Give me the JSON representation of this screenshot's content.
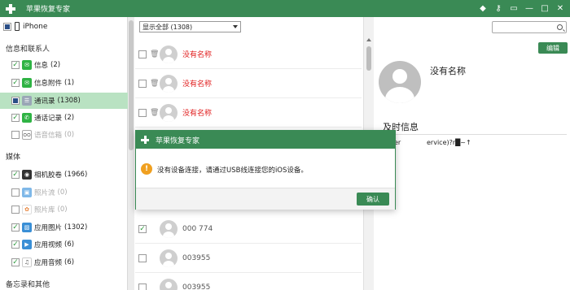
{
  "app": {
    "title": "苹果恢复专家"
  },
  "titlebar_icons": [
    "diamond-icon",
    "key-icon",
    "message-icon",
    "minimize-icon",
    "maximize-icon",
    "close-icon"
  ],
  "sidebar": {
    "device": "iPhone",
    "sections": [
      {
        "title": "信息和联系人",
        "items": [
          {
            "label": "信息",
            "count": "(2)",
            "state": "checked",
            "icon_color": "#2fb344",
            "icon": "message-icon"
          },
          {
            "label": "信息附件",
            "count": "(1)",
            "state": "checked",
            "icon_color": "#2fb344",
            "icon": "attachment-icon"
          },
          {
            "label": "通讯录",
            "count": "(1308)",
            "state": "partial",
            "icon_color": "#9aa6b6",
            "icon": "contacts-icon",
            "active": true
          },
          {
            "label": "通话记录",
            "count": "(2)",
            "state": "checked",
            "icon_color": "#2fb344",
            "icon": "phone-icon"
          },
          {
            "label": "语音信箱",
            "count": "(0)",
            "state": "empty",
            "icon_color": "#ffffff",
            "icon": "voicemail-icon",
            "disabled": true
          }
        ]
      },
      {
        "title": "媒体",
        "items": [
          {
            "label": "相机胶卷",
            "count": "(1966)",
            "state": "checked",
            "icon_color": "#333333",
            "icon": "camera-icon"
          },
          {
            "label": "照片流",
            "count": "(0)",
            "state": "empty",
            "icon_color": "#7fb8e8",
            "icon": "photostream-icon",
            "disabled": true
          },
          {
            "label": "照片库",
            "count": "(0)",
            "state": "empty",
            "icon_color": "#f4b942",
            "icon": "photo-library-icon",
            "disabled": true
          },
          {
            "label": "应用图片",
            "count": "(1302)",
            "state": "checked",
            "icon_color": "#3a8fd6",
            "icon": "app-photo-icon"
          },
          {
            "label": "应用视频",
            "count": "(6)",
            "state": "checked",
            "icon_color": "#3a8fd6",
            "icon": "app-video-icon"
          },
          {
            "label": "应用音频",
            "count": "(6)",
            "state": "checked",
            "icon_color": "#ffffff",
            "icon": "app-audio-icon"
          }
        ]
      },
      {
        "title": "备忘录和其他",
        "items": []
      }
    ]
  },
  "list": {
    "filter": "显示全部 (1308)",
    "rows": [
      {
        "name": "没有名称",
        "red": true,
        "checked": false
      },
      {
        "name": "没有名称",
        "red": true,
        "checked": false
      },
      {
        "name": "没有名称",
        "red": true,
        "checked": false
      },
      {
        "name": "000 774",
        "red": false,
        "checked": true
      },
      {
        "name": "003955",
        "red": false,
        "checked": false
      },
      {
        "name": "003955",
        "red": false,
        "checked": false
      }
    ]
  },
  "detail": {
    "search_placeholder": "",
    "edit_label": "编辑",
    "name": "没有名称",
    "section": "及时信息",
    "row_label": "er",
    "row_value": "ervice)?r█~↑"
  },
  "dialog": {
    "title": "苹果恢复专家",
    "message": "没有设备连接，请通过USB线连接您的iOS设备。",
    "ok_label": "确认"
  },
  "colors": {
    "brand_green": "#3a8a55",
    "active_row": "#b9e2c2",
    "unnamed_red": "#e01c1c",
    "warning": "#f0a020"
  }
}
